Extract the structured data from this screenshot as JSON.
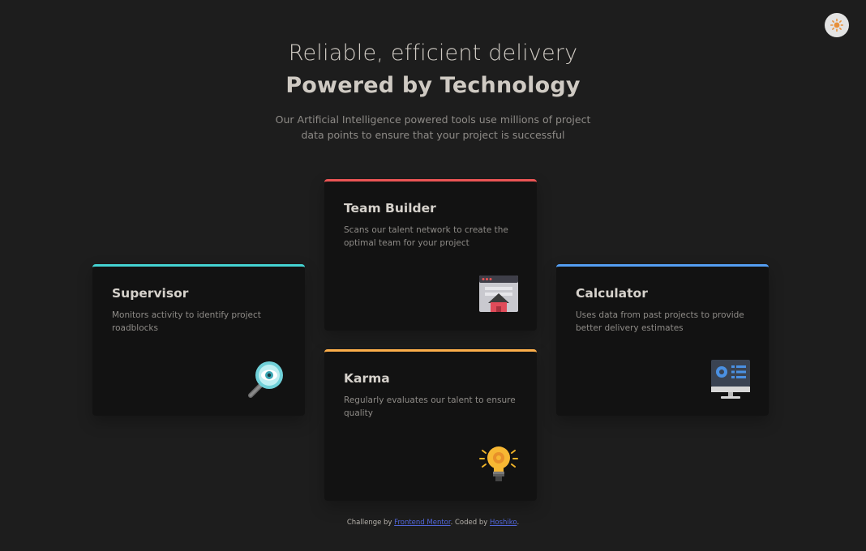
{
  "theme_toggle": {
    "icon": "sun-icon",
    "color": "#e8903a"
  },
  "hero": {
    "line1": "Reliable, efficient delivery",
    "line2": "Powered by Technology",
    "description": "Our Artificial Intelligence powered tools use millions of project data points to ensure that your project is successful"
  },
  "cards": {
    "supervisor": {
      "title": "Supervisor",
      "description": "Monitors activity to identify project roadblocks",
      "accent": "#44d3d2",
      "icon": "magnifier-eye-icon"
    },
    "team_builder": {
      "title": "Team Builder",
      "description": "Scans our talent network to create the optimal team for your project",
      "accent": "#ea5454",
      "icon": "browser-house-icon"
    },
    "karma": {
      "title": "Karma",
      "description": "Regularly evaluates our talent to ensure quality",
      "accent": "#fcae4a",
      "icon": "lightbulb-icon"
    },
    "calculator": {
      "title": "Calculator",
      "description": "Uses data from past projects to provide better delivery estimates",
      "accent": "#549ef2",
      "icon": "monitor-icon"
    }
  },
  "footer": {
    "prefix": "Challenge by ",
    "link1": "Frontend Mentor",
    "middle": ". Coded by ",
    "link2": "Hoshiko",
    "suffix": "."
  }
}
